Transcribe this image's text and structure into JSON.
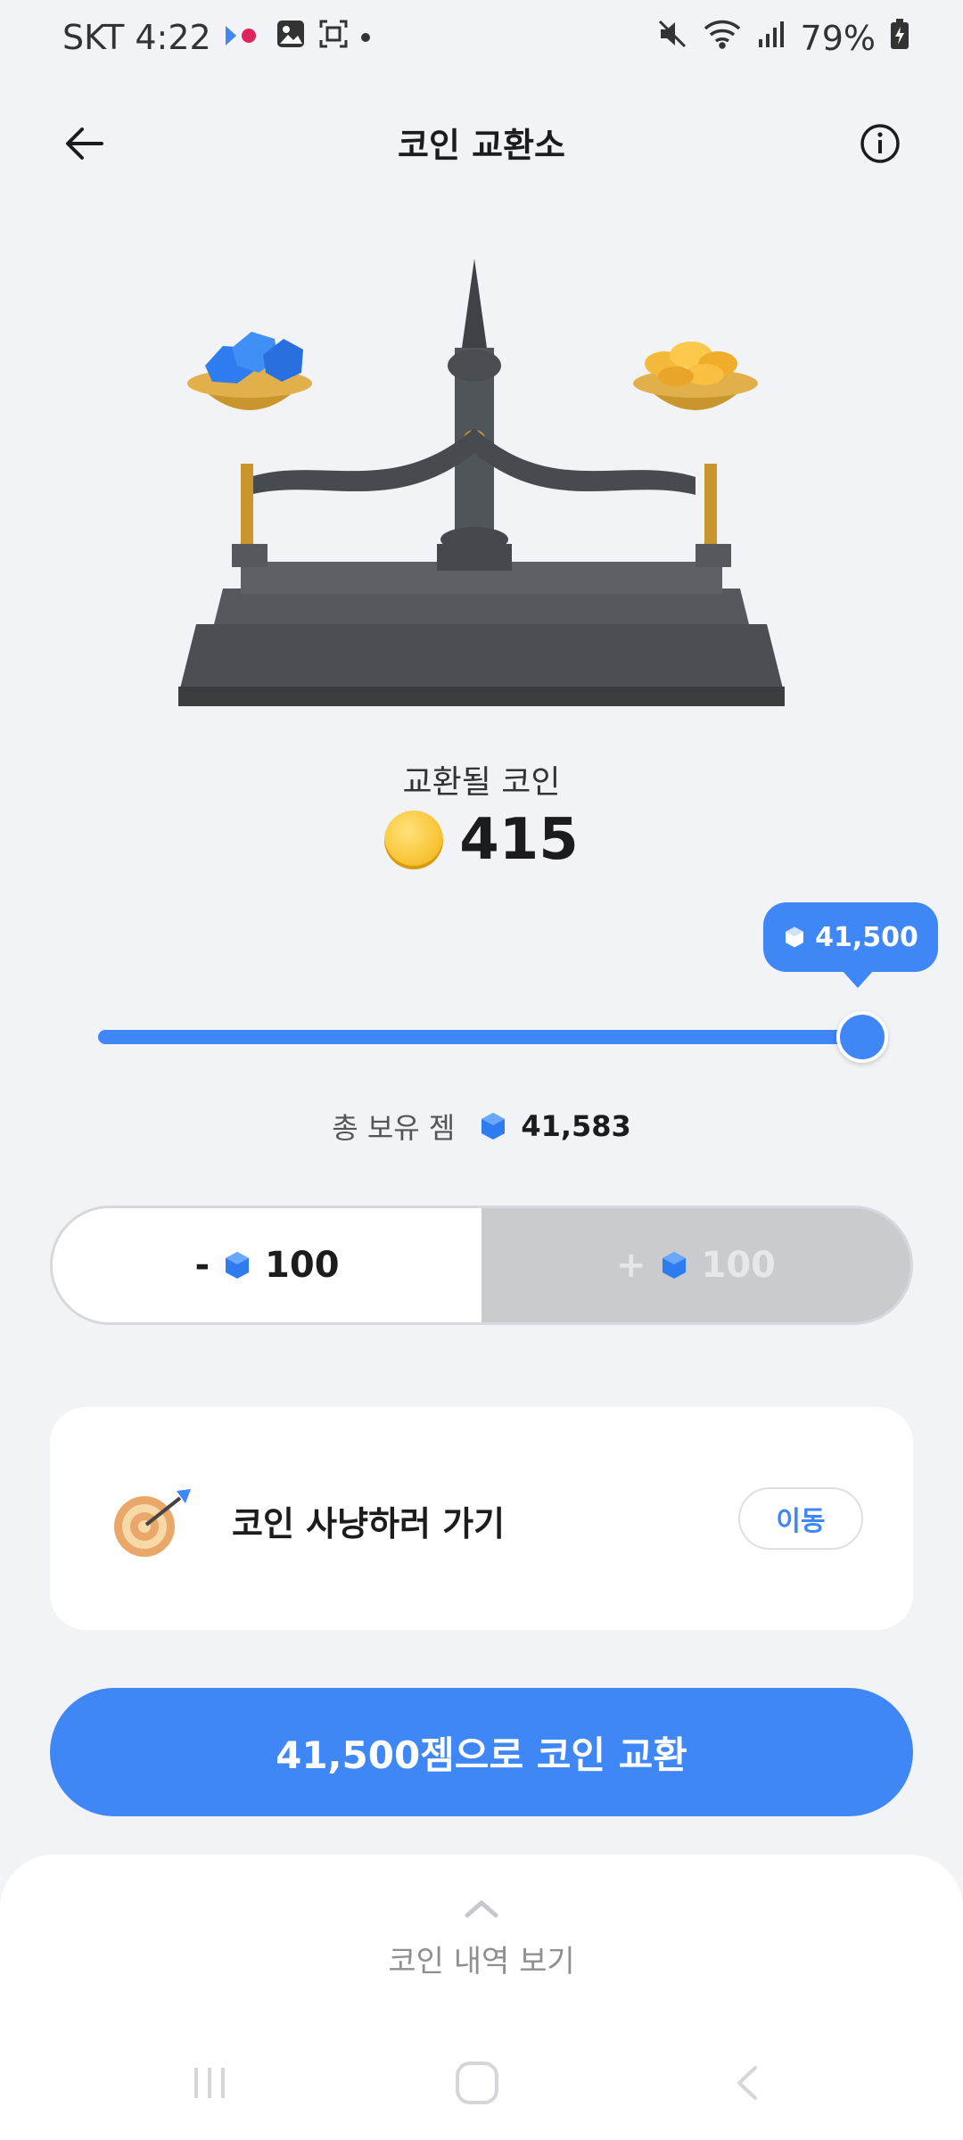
{
  "status_bar": {
    "carrier_time": "SKT 4:22",
    "battery": "79%"
  },
  "header": {
    "title": "코인 교환소"
  },
  "exchange": {
    "label": "교환될 코인",
    "coin_amount": "415"
  },
  "slider": {
    "tooltip_value": "41,500",
    "level_fraction": 1.0
  },
  "total": {
    "label": "총 보유 젬",
    "value": "41,583"
  },
  "stepper": {
    "minus_sign": "-",
    "minus_value": "100",
    "plus_sign": "+",
    "plus_value": "100"
  },
  "hunt_card": {
    "label": "코인 사냥하러 가기",
    "button": "이동"
  },
  "cta": {
    "label": "41,500젬으로 코인 교환"
  },
  "bottom_sheet": {
    "label": "코인 내역 보기"
  },
  "colors": {
    "accent": "#3f86f7",
    "background": "#f2f3f7",
    "disabled": "#c9cbcf"
  }
}
